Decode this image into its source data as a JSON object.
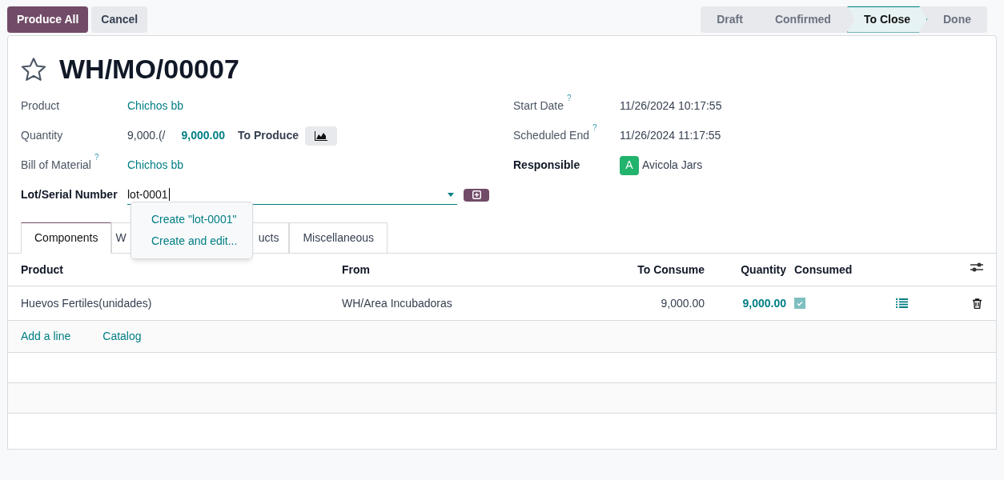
{
  "actions": [
    {
      "label": "Produce All",
      "kind": "primary"
    },
    {
      "label": "Cancel",
      "kind": "secondary"
    }
  ],
  "stages": [
    {
      "label": "Draft",
      "selected": false
    },
    {
      "label": "Confirmed",
      "selected": false
    },
    {
      "label": "To Close",
      "selected": true
    },
    {
      "label": "Done",
      "selected": false
    }
  ],
  "record": {
    "title": "WH/MO/00007",
    "starred": false
  },
  "left_fields": [
    {
      "label": "Product",
      "value": "Chichos bb",
      "kind": "link",
      "required": false
    },
    {
      "label": "Quantity",
      "kind": "quantity",
      "value": "9,000.(/",
      "produced": "9,000.00",
      "suffix": "To Produce",
      "required": false
    },
    {
      "label": "Bill of Material",
      "value": "Chichos bb",
      "kind": "link",
      "help": "?",
      "required": false
    },
    {
      "label": "Lot/Serial Number",
      "value": "lot-0001",
      "kind": "input",
      "required": true
    }
  ],
  "right_fields": [
    {
      "label": "Start Date",
      "value": "11/26/2024 10:17:55",
      "kind": "text",
      "help": "?",
      "required": false
    },
    {
      "label": "Scheduled End",
      "value": "11/26/2024 11:17:55",
      "kind": "text",
      "help": "?",
      "required": false
    },
    {
      "label": "Responsible",
      "value": "Avicola Jars",
      "initial": "A",
      "kind": "user",
      "required": true
    }
  ],
  "dropdown": [
    "Create \"lot-0001\"",
    "Create and edit..."
  ],
  "tabs": [
    {
      "label": "Components",
      "selected": true
    },
    {
      "label": "W",
      "selected": false
    },
    {
      "label": "ucts",
      "selected": false
    },
    {
      "label": "Miscellaneous",
      "selected": false
    }
  ],
  "table": {
    "columns": [
      "Product",
      "From",
      "To Consume",
      "Quantity",
      "Consumed"
    ],
    "rows": [
      {
        "product": "Huevos Fertiles(unidades)",
        "from": "WH/Area Incubadoras",
        "to_consume": "9,000.00",
        "quantity": "9,000.00",
        "consumed": true
      }
    ],
    "footer_links": [
      "Add a line",
      "Catalog"
    ]
  }
}
